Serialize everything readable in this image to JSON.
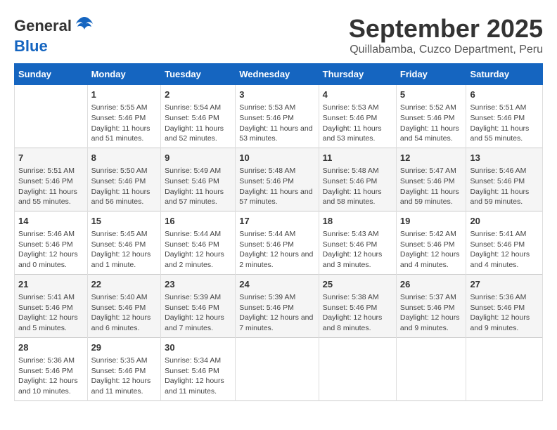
{
  "logo": {
    "general": "General",
    "blue": "Blue"
  },
  "title": "September 2025",
  "subtitle": "Quillabamba, Cuzco Department, Peru",
  "days_header": [
    "Sunday",
    "Monday",
    "Tuesday",
    "Wednesday",
    "Thursday",
    "Friday",
    "Saturday"
  ],
  "weeks": [
    [
      {
        "num": "",
        "sunrise": "",
        "sunset": "",
        "daylight": ""
      },
      {
        "num": "1",
        "sunrise": "Sunrise: 5:55 AM",
        "sunset": "Sunset: 5:46 PM",
        "daylight": "Daylight: 11 hours and 51 minutes."
      },
      {
        "num": "2",
        "sunrise": "Sunrise: 5:54 AM",
        "sunset": "Sunset: 5:46 PM",
        "daylight": "Daylight: 11 hours and 52 minutes."
      },
      {
        "num": "3",
        "sunrise": "Sunrise: 5:53 AM",
        "sunset": "Sunset: 5:46 PM",
        "daylight": "Daylight: 11 hours and 53 minutes."
      },
      {
        "num": "4",
        "sunrise": "Sunrise: 5:53 AM",
        "sunset": "Sunset: 5:46 PM",
        "daylight": "Daylight: 11 hours and 53 minutes."
      },
      {
        "num": "5",
        "sunrise": "Sunrise: 5:52 AM",
        "sunset": "Sunset: 5:46 PM",
        "daylight": "Daylight: 11 hours and 54 minutes."
      },
      {
        "num": "6",
        "sunrise": "Sunrise: 5:51 AM",
        "sunset": "Sunset: 5:46 PM",
        "daylight": "Daylight: 11 hours and 55 minutes."
      }
    ],
    [
      {
        "num": "7",
        "sunrise": "Sunrise: 5:51 AM",
        "sunset": "Sunset: 5:46 PM",
        "daylight": "Daylight: 11 hours and 55 minutes."
      },
      {
        "num": "8",
        "sunrise": "Sunrise: 5:50 AM",
        "sunset": "Sunset: 5:46 PM",
        "daylight": "Daylight: 11 hours and 56 minutes."
      },
      {
        "num": "9",
        "sunrise": "Sunrise: 5:49 AM",
        "sunset": "Sunset: 5:46 PM",
        "daylight": "Daylight: 11 hours and 57 minutes."
      },
      {
        "num": "10",
        "sunrise": "Sunrise: 5:48 AM",
        "sunset": "Sunset: 5:46 PM",
        "daylight": "Daylight: 11 hours and 57 minutes."
      },
      {
        "num": "11",
        "sunrise": "Sunrise: 5:48 AM",
        "sunset": "Sunset: 5:46 PM",
        "daylight": "Daylight: 11 hours and 58 minutes."
      },
      {
        "num": "12",
        "sunrise": "Sunrise: 5:47 AM",
        "sunset": "Sunset: 5:46 PM",
        "daylight": "Daylight: 11 hours and 59 minutes."
      },
      {
        "num": "13",
        "sunrise": "Sunrise: 5:46 AM",
        "sunset": "Sunset: 5:46 PM",
        "daylight": "Daylight: 11 hours and 59 minutes."
      }
    ],
    [
      {
        "num": "14",
        "sunrise": "Sunrise: 5:46 AM",
        "sunset": "Sunset: 5:46 PM",
        "daylight": "Daylight: 12 hours and 0 minutes."
      },
      {
        "num": "15",
        "sunrise": "Sunrise: 5:45 AM",
        "sunset": "Sunset: 5:46 PM",
        "daylight": "Daylight: 12 hours and 1 minute."
      },
      {
        "num": "16",
        "sunrise": "Sunrise: 5:44 AM",
        "sunset": "Sunset: 5:46 PM",
        "daylight": "Daylight: 12 hours and 2 minutes."
      },
      {
        "num": "17",
        "sunrise": "Sunrise: 5:44 AM",
        "sunset": "Sunset: 5:46 PM",
        "daylight": "Daylight: 12 hours and 2 minutes."
      },
      {
        "num": "18",
        "sunrise": "Sunrise: 5:43 AM",
        "sunset": "Sunset: 5:46 PM",
        "daylight": "Daylight: 12 hours and 3 minutes."
      },
      {
        "num": "19",
        "sunrise": "Sunrise: 5:42 AM",
        "sunset": "Sunset: 5:46 PM",
        "daylight": "Daylight: 12 hours and 4 minutes."
      },
      {
        "num": "20",
        "sunrise": "Sunrise: 5:41 AM",
        "sunset": "Sunset: 5:46 PM",
        "daylight": "Daylight: 12 hours and 4 minutes."
      }
    ],
    [
      {
        "num": "21",
        "sunrise": "Sunrise: 5:41 AM",
        "sunset": "Sunset: 5:46 PM",
        "daylight": "Daylight: 12 hours and 5 minutes."
      },
      {
        "num": "22",
        "sunrise": "Sunrise: 5:40 AM",
        "sunset": "Sunset: 5:46 PM",
        "daylight": "Daylight: 12 hours and 6 minutes."
      },
      {
        "num": "23",
        "sunrise": "Sunrise: 5:39 AM",
        "sunset": "Sunset: 5:46 PM",
        "daylight": "Daylight: 12 hours and 7 minutes."
      },
      {
        "num": "24",
        "sunrise": "Sunrise: 5:39 AM",
        "sunset": "Sunset: 5:46 PM",
        "daylight": "Daylight: 12 hours and 7 minutes."
      },
      {
        "num": "25",
        "sunrise": "Sunrise: 5:38 AM",
        "sunset": "Sunset: 5:46 PM",
        "daylight": "Daylight: 12 hours and 8 minutes."
      },
      {
        "num": "26",
        "sunrise": "Sunrise: 5:37 AM",
        "sunset": "Sunset: 5:46 PM",
        "daylight": "Daylight: 12 hours and 9 minutes."
      },
      {
        "num": "27",
        "sunrise": "Sunrise: 5:36 AM",
        "sunset": "Sunset: 5:46 PM",
        "daylight": "Daylight: 12 hours and 9 minutes."
      }
    ],
    [
      {
        "num": "28",
        "sunrise": "Sunrise: 5:36 AM",
        "sunset": "Sunset: 5:46 PM",
        "daylight": "Daylight: 12 hours and 10 minutes."
      },
      {
        "num": "29",
        "sunrise": "Sunrise: 5:35 AM",
        "sunset": "Sunset: 5:46 PM",
        "daylight": "Daylight: 12 hours and 11 minutes."
      },
      {
        "num": "30",
        "sunrise": "Sunrise: 5:34 AM",
        "sunset": "Sunset: 5:46 PM",
        "daylight": "Daylight: 12 hours and 11 minutes."
      },
      {
        "num": "",
        "sunrise": "",
        "sunset": "",
        "daylight": ""
      },
      {
        "num": "",
        "sunrise": "",
        "sunset": "",
        "daylight": ""
      },
      {
        "num": "",
        "sunrise": "",
        "sunset": "",
        "daylight": ""
      },
      {
        "num": "",
        "sunrise": "",
        "sunset": "",
        "daylight": ""
      }
    ]
  ]
}
